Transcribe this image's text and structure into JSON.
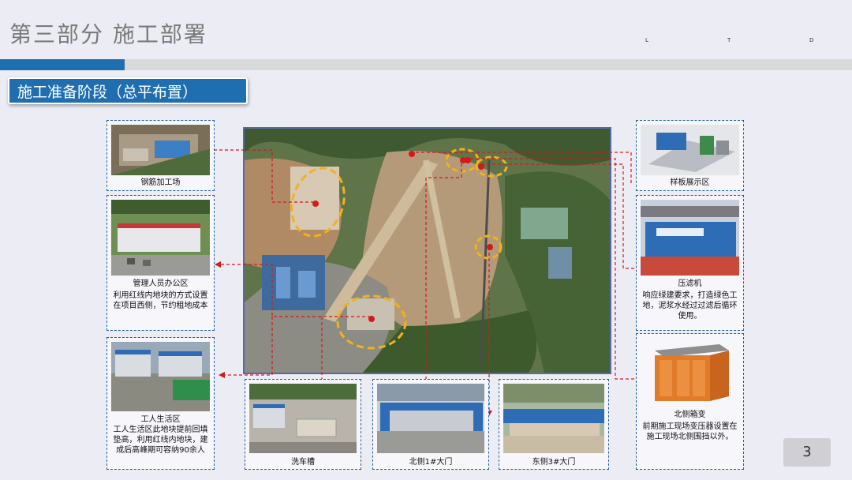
{
  "header": {
    "title": "第三部分  施工部署",
    "marks": [
      "L",
      "T",
      "D"
    ]
  },
  "stage_label": "施工准备阶段（总平布置）",
  "cards": {
    "rebar": {
      "caption": "钢筋加工场"
    },
    "office": {
      "caption": "管理人员办公区",
      "desc": "利用红线内地块的方式设置在项目西侧，节约租地成本"
    },
    "worker": {
      "caption": "工人生活区",
      "desc": "工人生活区此地块提前回填垫高，利用红线内地块，建成后高峰期可容纳90余人"
    },
    "washing": {
      "caption": "洗车槽"
    },
    "north_gate": {
      "caption": "北侧1#大门"
    },
    "east_gate": {
      "caption": "东侧3#大门"
    },
    "sample": {
      "caption": "样板展示区"
    },
    "filter": {
      "caption": "压滤机",
      "desc": "响应绿建要求，打造绿色工地，泥浆水经过过滤后循环使用。"
    },
    "transformer": {
      "caption": "北侧箱变",
      "desc": "前期施工现场变压器设置在施工现场北侧围挡以外。"
    }
  },
  "page_number": "3",
  "colors": {
    "accent": "#1f6fb0",
    "marker": "#d11a1a",
    "highlight": "#f2b21b"
  }
}
